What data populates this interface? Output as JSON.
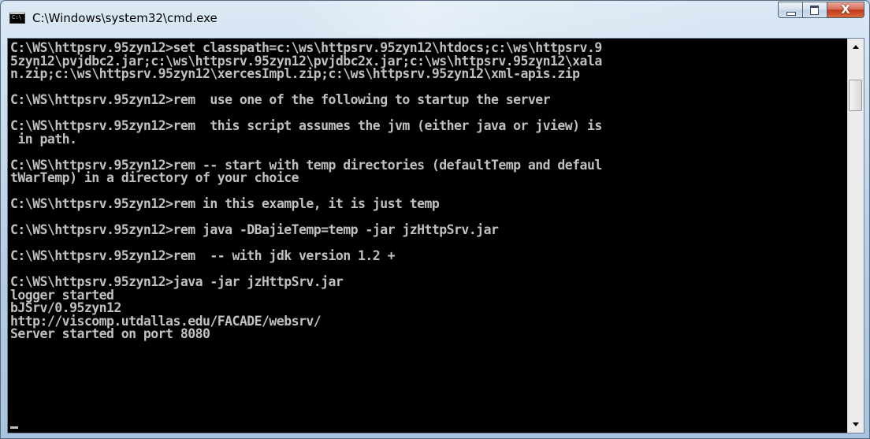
{
  "window": {
    "title": "C:\\Windows\\system32\\cmd.exe",
    "icon_name": "console-app-icon",
    "icon_text": "C:\\"
  },
  "caption_buttons": {
    "minimize": "minimize-icon",
    "maximize": "maximize-icon",
    "close": "X"
  },
  "console": {
    "lines": [
      "C:\\WS\\httpsrv.95zyn12>set classpath=c:\\ws\\httpsrv.95zyn12\\htdocs;c:\\ws\\httpsrv.9",
      "5zyn12\\pvjdbc2.jar;c:\\ws\\httpsrv.95zyn12\\pvjdbc2x.jar;c:\\ws\\httpsrv.95zyn12\\xala",
      "n.zip;c:\\ws\\httpsrv.95zyn12\\xercesImpl.zip;c:\\ws\\httpsrv.95zyn12\\xml-apis.zip",
      "",
      "C:\\WS\\httpsrv.95zyn12>rem  use one of the following to startup the server",
      "",
      "C:\\WS\\httpsrv.95zyn12>rem  this script assumes the jvm (either java or jview) is",
      " in path.",
      "",
      "C:\\WS\\httpsrv.95zyn12>rem -- start with temp directories (defaultTemp and defaul",
      "tWarTemp) in a directory of your choice",
      "",
      "C:\\WS\\httpsrv.95zyn12>rem in this example, it is just temp",
      "",
      "C:\\WS\\httpsrv.95zyn12>rem java -DBajieTemp=temp -jar jzHttpSrv.jar",
      "",
      "C:\\WS\\httpsrv.95zyn12>rem  -- with jdk version 1.2 +",
      "",
      "C:\\WS\\httpsrv.95zyn12>java -jar jzHttpSrv.jar",
      "logger started",
      "bJSrv/0.95zyn12",
      "http://viscomp.utdallas.edu/FACADE/websrv/",
      "Server started on port 8080"
    ]
  },
  "scrollbar": {
    "up_icon": "scroll-up-arrow-icon",
    "down_icon": "scroll-down-arrow-icon"
  }
}
